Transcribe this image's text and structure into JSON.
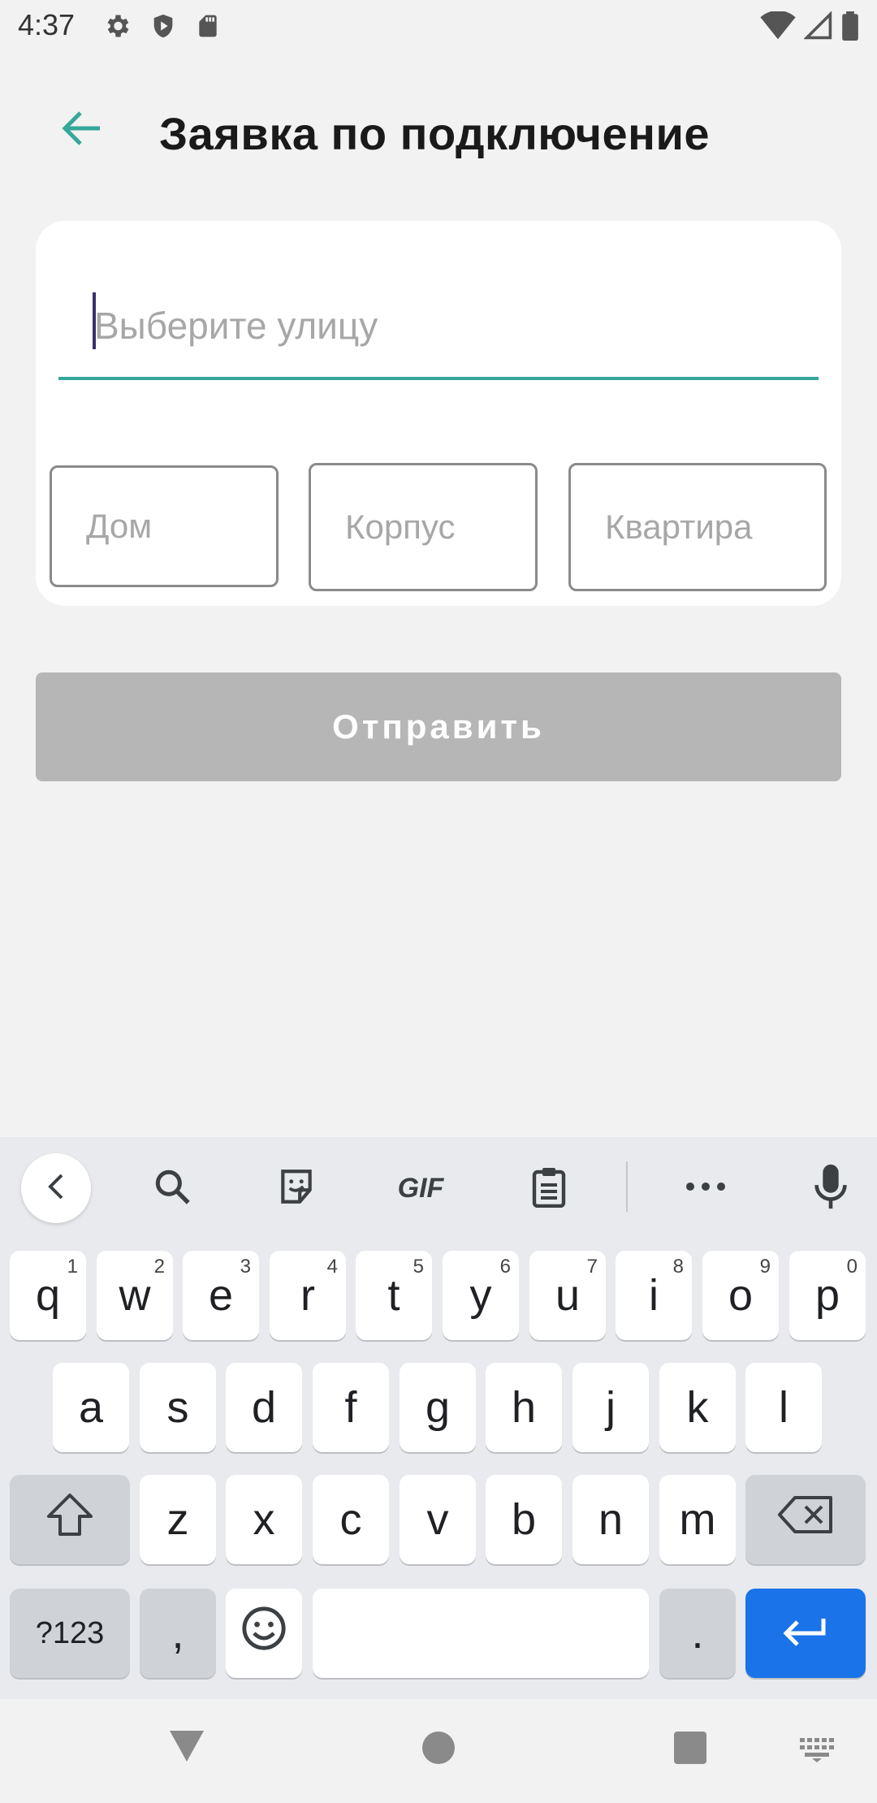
{
  "status_bar": {
    "time": "4:37",
    "left_icons": [
      "gear-icon",
      "shield-play-icon",
      "sd-card-icon"
    ],
    "right_icons": [
      "wifi-icon",
      "signal-icon",
      "battery-icon"
    ]
  },
  "app_bar": {
    "back_icon": "arrow-left-icon",
    "title": "Заявка по подключение"
  },
  "form": {
    "street_placeholder": "Выберите улицу",
    "house_placeholder": "Дом",
    "building_placeholder": "Корпус",
    "apartment_placeholder": "Квартира"
  },
  "submit": {
    "label": "Отправить",
    "enabled": false
  },
  "colors": {
    "accent": "#34a79a",
    "disabled_button": "#b6b6b6",
    "keyboard_enter": "#1a73e8"
  },
  "keyboard": {
    "toolbar": [
      "chevron-left-icon",
      "search-icon",
      "sticker-icon",
      "GIF",
      "clipboard-icon",
      "more-icon",
      "mic-icon"
    ],
    "row1": [
      {
        "k": "q",
        "h": "1"
      },
      {
        "k": "w",
        "h": "2"
      },
      {
        "k": "e",
        "h": "3"
      },
      {
        "k": "r",
        "h": "4"
      },
      {
        "k": "t",
        "h": "5"
      },
      {
        "k": "y",
        "h": "6"
      },
      {
        "k": "u",
        "h": "7"
      },
      {
        "k": "i",
        "h": "8"
      },
      {
        "k": "o",
        "h": "9"
      },
      {
        "k": "p",
        "h": "0"
      }
    ],
    "row2": [
      "a",
      "s",
      "d",
      "f",
      "g",
      "h",
      "j",
      "k",
      "l"
    ],
    "row3": [
      "z",
      "x",
      "c",
      "v",
      "b",
      "n",
      "m"
    ],
    "symbols_label": "?123",
    "comma": ",",
    "period": "."
  },
  "nav_bar": [
    "back-triangle-icon",
    "home-circle-icon",
    "recents-square-icon",
    "keyboard-switch-icon"
  ]
}
